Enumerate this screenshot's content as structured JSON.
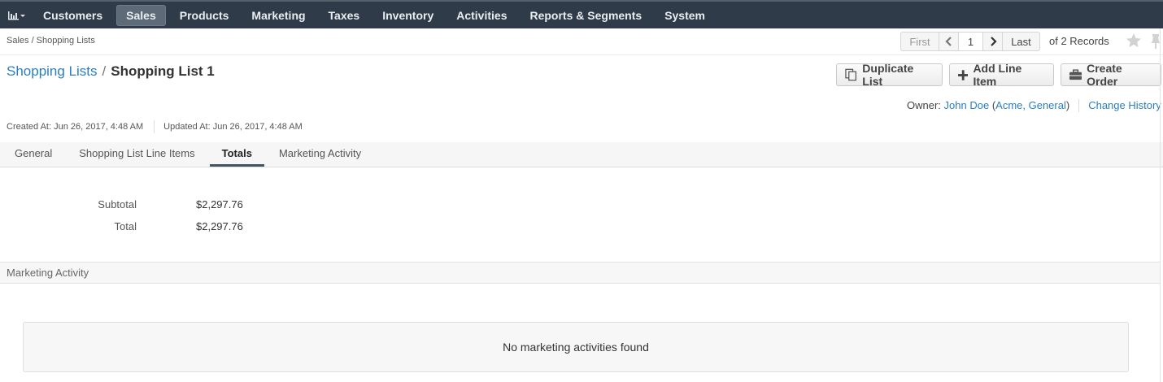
{
  "nav": {
    "logo_icon": "chart-icon",
    "items": [
      {
        "label": "Customers"
      },
      {
        "label": "Sales"
      },
      {
        "label": "Products"
      },
      {
        "label": "Marketing"
      },
      {
        "label": "Taxes"
      },
      {
        "label": "Inventory"
      },
      {
        "label": "Activities"
      },
      {
        "label": "Reports & Segments"
      },
      {
        "label": "System"
      }
    ],
    "active": "Sales"
  },
  "breadcrumb": "Sales / Shopping Lists",
  "pager": {
    "first": "First",
    "current": "1",
    "last": "Last",
    "records": "of 2 Records"
  },
  "title": {
    "parent": "Shopping Lists",
    "separator": "/",
    "current": "Shopping List 1"
  },
  "actions": {
    "duplicate": "Duplicate List",
    "add_line": "Add Line Item",
    "create_order": "Create Order"
  },
  "owner": {
    "label": "Owner:",
    "name": "John Doe",
    "org_open": "(",
    "org": "Acme, General",
    "org_close": ")",
    "change_history": "Change History"
  },
  "meta": {
    "created": "Created At: Jun 26, 2017, 4:48 AM",
    "updated": "Updated At: Jun 26, 2017, 4:48 AM"
  },
  "tabs": [
    {
      "label": "General"
    },
    {
      "label": "Shopping List Line Items"
    },
    {
      "label": "Totals"
    },
    {
      "label": "Marketing Activity"
    }
  ],
  "active_tab": "Totals",
  "totals": {
    "subtotal_label": "Subtotal",
    "subtotal_value": "$2,297.76",
    "total_label": "Total",
    "total_value": "$2,297.76"
  },
  "marketing": {
    "section_title": "Marketing Activity",
    "empty_message": "No marketing activities found"
  },
  "colors": {
    "nav_bg": "#2f3b48",
    "link": "#2b7ec1"
  }
}
